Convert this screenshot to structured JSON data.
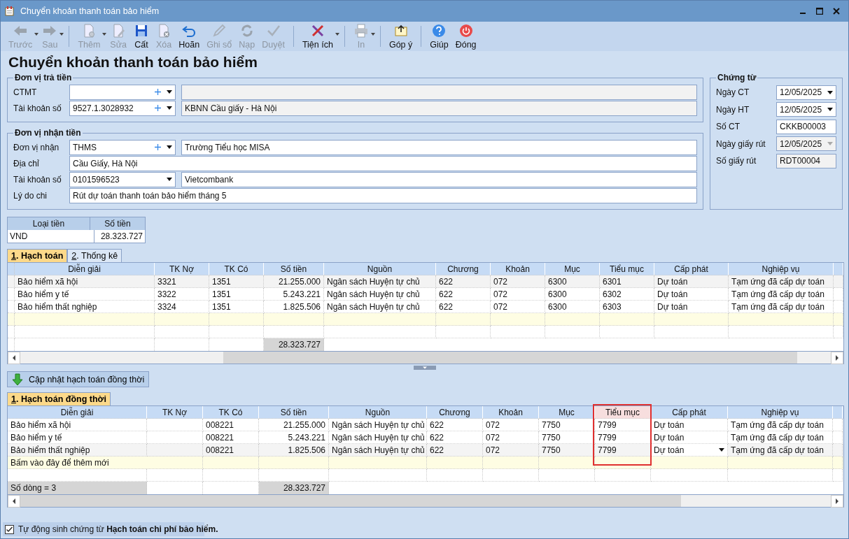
{
  "window": {
    "title": "Chuyển khoản thanh toán bảo hiểm"
  },
  "toolbar": [
    {
      "kind": "button",
      "label": "Trước",
      "disabled": true,
      "dropdown": true
    },
    {
      "kind": "button",
      "label": "Sau",
      "disabled": true,
      "dropdown": true
    },
    {
      "kind": "separator"
    },
    {
      "kind": "button",
      "label": "Thêm",
      "disabled": true,
      "dropdown": true
    },
    {
      "kind": "button",
      "label": "Sửa",
      "disabled": true,
      "dropdown": false
    },
    {
      "kind": "button",
      "label": "Cất",
      "disabled": false,
      "dropdown": false
    },
    {
      "kind": "button",
      "label": "Xóa",
      "disabled": true,
      "dropdown": false
    },
    {
      "kind": "button",
      "label": "Hoãn",
      "disabled": false,
      "dropdown": false
    },
    {
      "kind": "button",
      "label": "Ghi sổ",
      "disabled": true,
      "dropdown": false
    },
    {
      "kind": "button",
      "label": "Nạp",
      "disabled": true,
      "dropdown": false
    },
    {
      "kind": "button",
      "label": "Duyệt",
      "disabled": true,
      "dropdown": false
    },
    {
      "kind": "separator"
    },
    {
      "kind": "button",
      "label": "Tiện ích",
      "disabled": false,
      "dropdown": true
    },
    {
      "kind": "separator"
    },
    {
      "kind": "button",
      "label": "In",
      "disabled": true,
      "dropdown": true
    },
    {
      "kind": "separator"
    },
    {
      "kind": "button",
      "label": "Góp ý",
      "disabled": false,
      "dropdown": false
    },
    {
      "kind": "separator"
    },
    {
      "kind": "button",
      "label": "Giúp",
      "disabled": false,
      "dropdown": false
    },
    {
      "kind": "button",
      "label": "Đóng",
      "disabled": false,
      "dropdown": false
    }
  ],
  "heading": "Chuyển khoản thanh toán bảo hiểm",
  "payer": {
    "title": "Đơn vị trả tiền",
    "fields": [
      {
        "kind": "combo_pair",
        "label": "CTMT",
        "plus": true,
        "name_readonly": true
      },
      {
        "kind": "combo_pair",
        "label": "Tài khoản số",
        "code": "9527.1.3028932",
        "plus": true,
        "name": "KBNN Cầu giấy - Hà Nội",
        "name_readonly": true
      }
    ]
  },
  "receiver": {
    "title": "Đơn vị nhận tiền",
    "fields": [
      {
        "kind": "combo_pair",
        "label": "Đơn vị nhận",
        "code": "THMS",
        "plus": true,
        "name": "Trường Tiểu học MISA",
        "name_readonly": false
      },
      {
        "kind": "text",
        "label": "Địa chỉ",
        "value": "Cầu Giấy, Hà Nội"
      },
      {
        "kind": "combo_pair",
        "label": "Tài khoản số",
        "code": "0101596523",
        "plus": false,
        "name": "Vietcombank",
        "name_readonly": false
      },
      {
        "kind": "text",
        "label": "Lý do chi",
        "value": "Rút dự toán thanh toán bảo hiểm tháng 5"
      }
    ]
  },
  "voucher": {
    "title": "Chứng từ",
    "fields": [
      {
        "kind": "date",
        "label": "Ngày CT",
        "value": "12/05/2025",
        "disabled": false
      },
      {
        "kind": "date",
        "label": "Ngày HT",
        "value": "12/05/2025",
        "disabled": false
      },
      {
        "kind": "text",
        "label": "Số CT",
        "value": "CKKB00003",
        "disabled": false
      },
      {
        "kind": "date",
        "label": "Ngày giấy rút",
        "value": "12/05/2025",
        "disabled": true
      },
      {
        "kind": "text",
        "label": "Số giấy rút",
        "value": "RDT00004",
        "disabled": true
      }
    ]
  },
  "currency": {
    "columns": [
      "Loại tiền",
      "Số tiền"
    ],
    "rows": [
      [
        "VND",
        "28.323.727"
      ]
    ]
  },
  "tabs": [
    {
      "key": "1",
      "label": ". Hạch toán",
      "selected": true
    },
    {
      "key": "2",
      "label": ". Thống kê",
      "selected": false
    }
  ],
  "grid": {
    "columns": [
      "Diễn giải",
      "TK Nợ",
      "TK Có",
      "Số tiền",
      "Nguồn",
      "Chương",
      "Khoản",
      "Mục",
      "Tiểu mục",
      "Cấp phát",
      "Nghiệp vụ"
    ],
    "rows": [
      {
        "selected": true,
        "cells": [
          "Bảo hiểm xã hội",
          "3321",
          "1351",
          "21.255.000",
          "Ngân sách Huyện tự chủ",
          "622",
          "072",
          "6300",
          "6301",
          "Dự toán",
          "Tạm ứng đã cấp dự toán"
        ]
      },
      {
        "selected": false,
        "cells": [
          "Bảo hiểm y tế",
          "3322",
          "1351",
          "5.243.221",
          "Ngân sách Huyện tự chủ",
          "622",
          "072",
          "6300",
          "6302",
          "Dự toán",
          "Tạm ứng đã cấp dự toán"
        ]
      },
      {
        "selected": false,
        "cells": [
          "Bảo hiểm thất nghiệp",
          "3324",
          "1351",
          "1.825.506",
          "Ngân sách Huyện tự chủ",
          "622",
          "072",
          "6300",
          "6303",
          "Dự toán",
          "Tạm ứng đã cấp dự toán"
        ]
      }
    ],
    "total": "28.323.727"
  },
  "update_button": "Cập nhật hạch toán đồng thời",
  "tabs2": [
    {
      "key": "1",
      "label": ". Hạch toán đồng thời",
      "selected": true
    }
  ],
  "grid2": {
    "columns": [
      {
        "label": "Diễn giải",
        "highlighted": false
      },
      {
        "label": "TK Nợ",
        "highlighted": false
      },
      {
        "label": "TK Có",
        "highlighted": false
      },
      {
        "label": "Số tiền",
        "highlighted": false
      },
      {
        "label": "Nguồn",
        "highlighted": false
      },
      {
        "label": "Chương",
        "highlighted": false
      },
      {
        "label": "Khoản",
        "highlighted": false
      },
      {
        "label": "Mục",
        "highlighted": false
      },
      {
        "label": "Tiểu mục",
        "highlighted": true
      },
      {
        "label": "Cấp phát",
        "highlighted": false
      },
      {
        "label": "Nghiệp vụ",
        "highlighted": false
      }
    ],
    "rows": [
      {
        "selected": false,
        "cells": [
          "Bảo hiểm xã hội",
          "",
          "008221",
          "21.255.000",
          "Ngân sách Huyện tự chủ",
          "622",
          "072",
          "7750",
          "7799",
          "Dự toán",
          "Tạm ứng đã cấp dự toán"
        ]
      },
      {
        "selected": false,
        "cells": [
          "Bảo hiểm y tế",
          "",
          "008221",
          "5.243.221",
          "Ngân sách Huyện tự chủ",
          "622",
          "072",
          "7750",
          "7799",
          "Dự toán",
          "Tạm ứng đã cấp dự toán"
        ]
      },
      {
        "selected": true,
        "cells": [
          "Bảo hiểm thất nghiệp",
          "",
          "008221",
          "1.825.506",
          "Ngân sách Huyện tự chủ",
          "622",
          "072",
          "7750",
          "7799",
          "Dự toán",
          "Tạm ứng đã cấp dự toán"
        ]
      }
    ],
    "new_row_placeholder": "Bấm vào đây để thêm mới",
    "row_count": "Số dòng = 3",
    "total": "28.323.727"
  },
  "auto_option": {
    "checked": true,
    "text": "Tự động sinh chứng từ **Hạch toán chi phí bảo hiểm.**"
  }
}
